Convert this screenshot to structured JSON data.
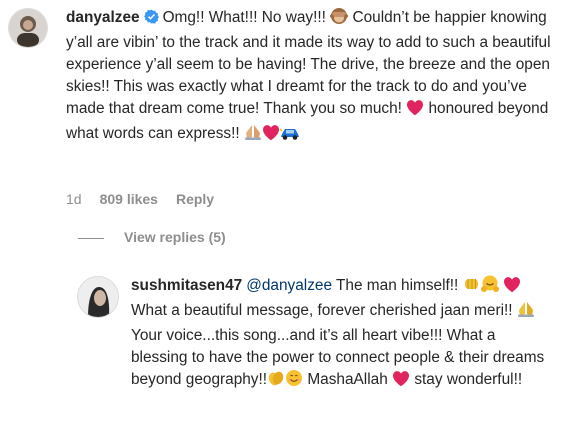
{
  "comment": {
    "username": "danyalzee",
    "verified": true,
    "text_part1": "Omg!! What!!! No way!!!",
    "text_part2": "Couldn’t be happier knowing y’all are vibin’ to the track and it made its way to add to such a beautiful experience y’all seem to be having! The drive, the breeze and the open skies!! This was exactly what I dreamt for the track to do and you’ve made that dream come true! Thank you so much!",
    "text_part3": "honoured beyond what words can express!!",
    "time": "1d",
    "likes": "809 likes",
    "reply_label": "Reply"
  },
  "view_replies": "View replies (5)",
  "reply": {
    "username": "sushmitasen47",
    "mention": "@danyalzee",
    "text_part1": "The man himself!!",
    "text_part2": "What a beautiful message, forever cherished jaan meri!!",
    "text_part3": "Your voice...this song...and it’s all heart vibe!!! What a blessing to have the power to connect people & their dreams beyond geography!!",
    "text_part4": "MashaAllah",
    "text_part5": "stay wonderful!!"
  },
  "icons": {
    "verified": "verified-badge-icon",
    "monkey": "see-no-evil-monkey-icon",
    "heart": "red-heart-icon",
    "pray": "folded-hands-icon",
    "car": "blue-car-icon",
    "fist": "oncoming-fist-icon",
    "hug": "hugging-face-icon",
    "clap": "clapping-hands-icon",
    "smile": "smiling-face-icon"
  },
  "colors": {
    "heart": "#e0245e",
    "verified": "#3897f0",
    "text": "#262626",
    "muted": "#8e8e8e",
    "mention": "#00376b"
  }
}
